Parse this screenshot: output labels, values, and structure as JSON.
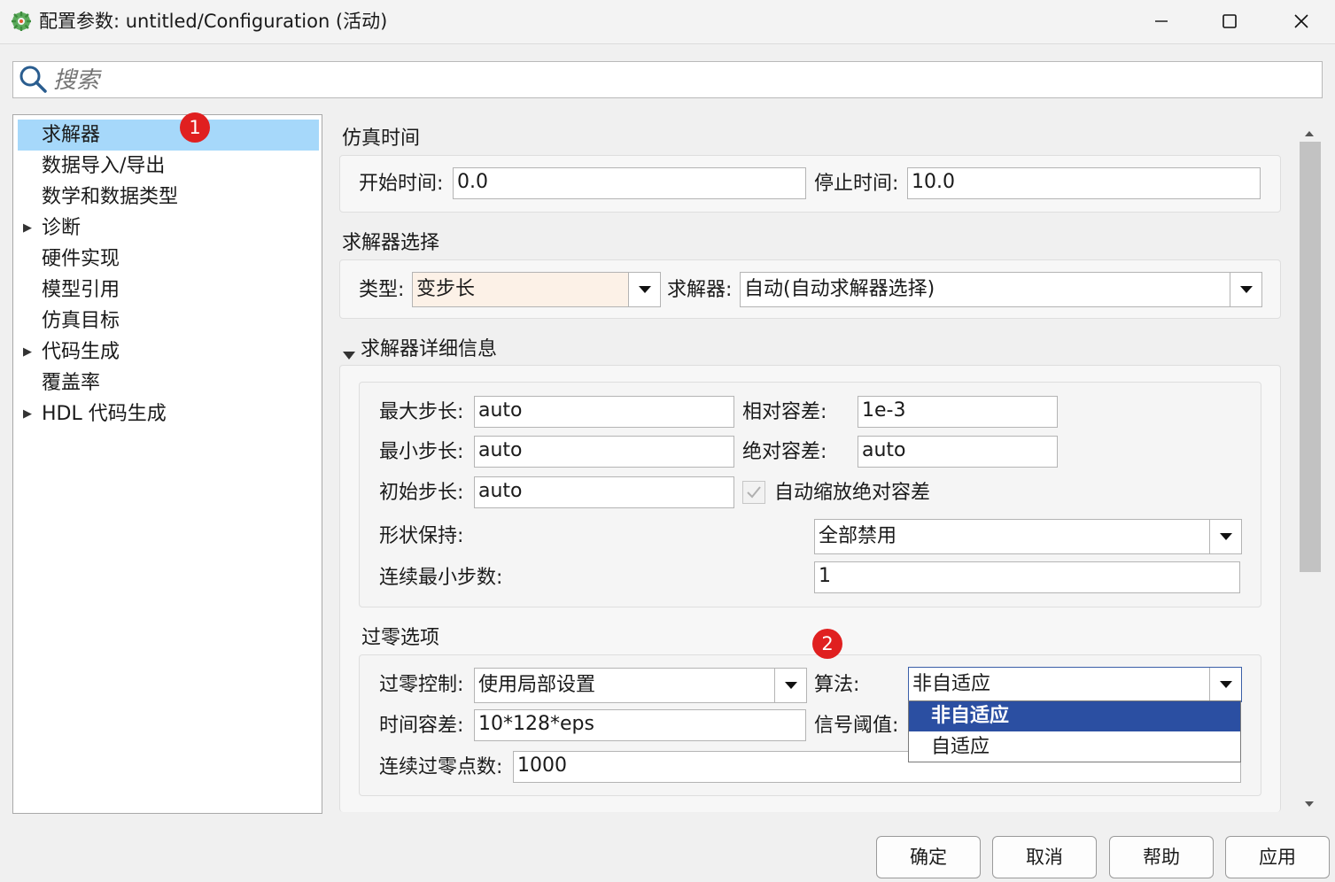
{
  "window": {
    "title": "配置参数: untitled/Configuration (活动)",
    "icon": "simulink-gear-icon"
  },
  "search": {
    "placeholder": "搜索"
  },
  "tree": {
    "items": [
      {
        "label": "求解器",
        "expandable": false,
        "selected": true
      },
      {
        "label": "数据导入/导出",
        "expandable": false
      },
      {
        "label": "数学和数据类型",
        "expandable": false
      },
      {
        "label": "诊断",
        "expandable": true
      },
      {
        "label": "硬件实现",
        "expandable": false
      },
      {
        "label": "模型引用",
        "expandable": false
      },
      {
        "label": "仿真目标",
        "expandable": false
      },
      {
        "label": "代码生成",
        "expandable": true
      },
      {
        "label": "覆盖率",
        "expandable": false
      },
      {
        "label": "HDL 代码生成",
        "expandable": true
      }
    ]
  },
  "badges": {
    "one": "1",
    "two": "2"
  },
  "sim_time": {
    "title": "仿真时间",
    "start_label": "开始时间:",
    "start_value": "0.0",
    "stop_label": "停止时间:",
    "stop_value": "10.0"
  },
  "solver_select": {
    "title": "求解器选择",
    "type_label": "类型:",
    "type_value": "变步长",
    "solver_label": "求解器:",
    "solver_value": "自动(自动求解器选择)"
  },
  "solver_details": {
    "title": "求解器详细信息",
    "max_step_label": "最大步长:",
    "max_step_value": "auto",
    "min_step_label": "最小步长:",
    "min_step_value": "auto",
    "init_step_label": "初始步长:",
    "init_step_value": "auto",
    "rel_tol_label": "相对容差:",
    "rel_tol_value": "1e-3",
    "abs_tol_label": "绝对容差:",
    "abs_tol_value": "auto",
    "auto_scale_label": "自动缩放绝对容差",
    "auto_scale_checked": true,
    "shape_label": "形状保持:",
    "shape_value": "全部禁用",
    "consec_min_label": "连续最小步数:",
    "consec_min_value": "1"
  },
  "zero_crossing": {
    "title": "过零选项",
    "control_label": "过零控制:",
    "control_value": "使用局部设置",
    "algorithm_label": "算法:",
    "algorithm_value": "非自适应",
    "time_tol_label": "时间容差:",
    "time_tol_value": "10*128*eps",
    "signal_thresh_label": "信号阈值:",
    "consec_zc_label": "连续过零点数:",
    "consec_zc_value": "1000",
    "algorithm_options": [
      "非自适应",
      "自适应"
    ]
  },
  "footer": {
    "ok": "确定",
    "cancel": "取消",
    "help": "帮助",
    "apply": "应用"
  },
  "colors": {
    "selection": "#a6d8fa",
    "dropdown_active": "#2b4fa2",
    "badge": "#e02020",
    "type_field_bg": "#fcf1e7"
  }
}
